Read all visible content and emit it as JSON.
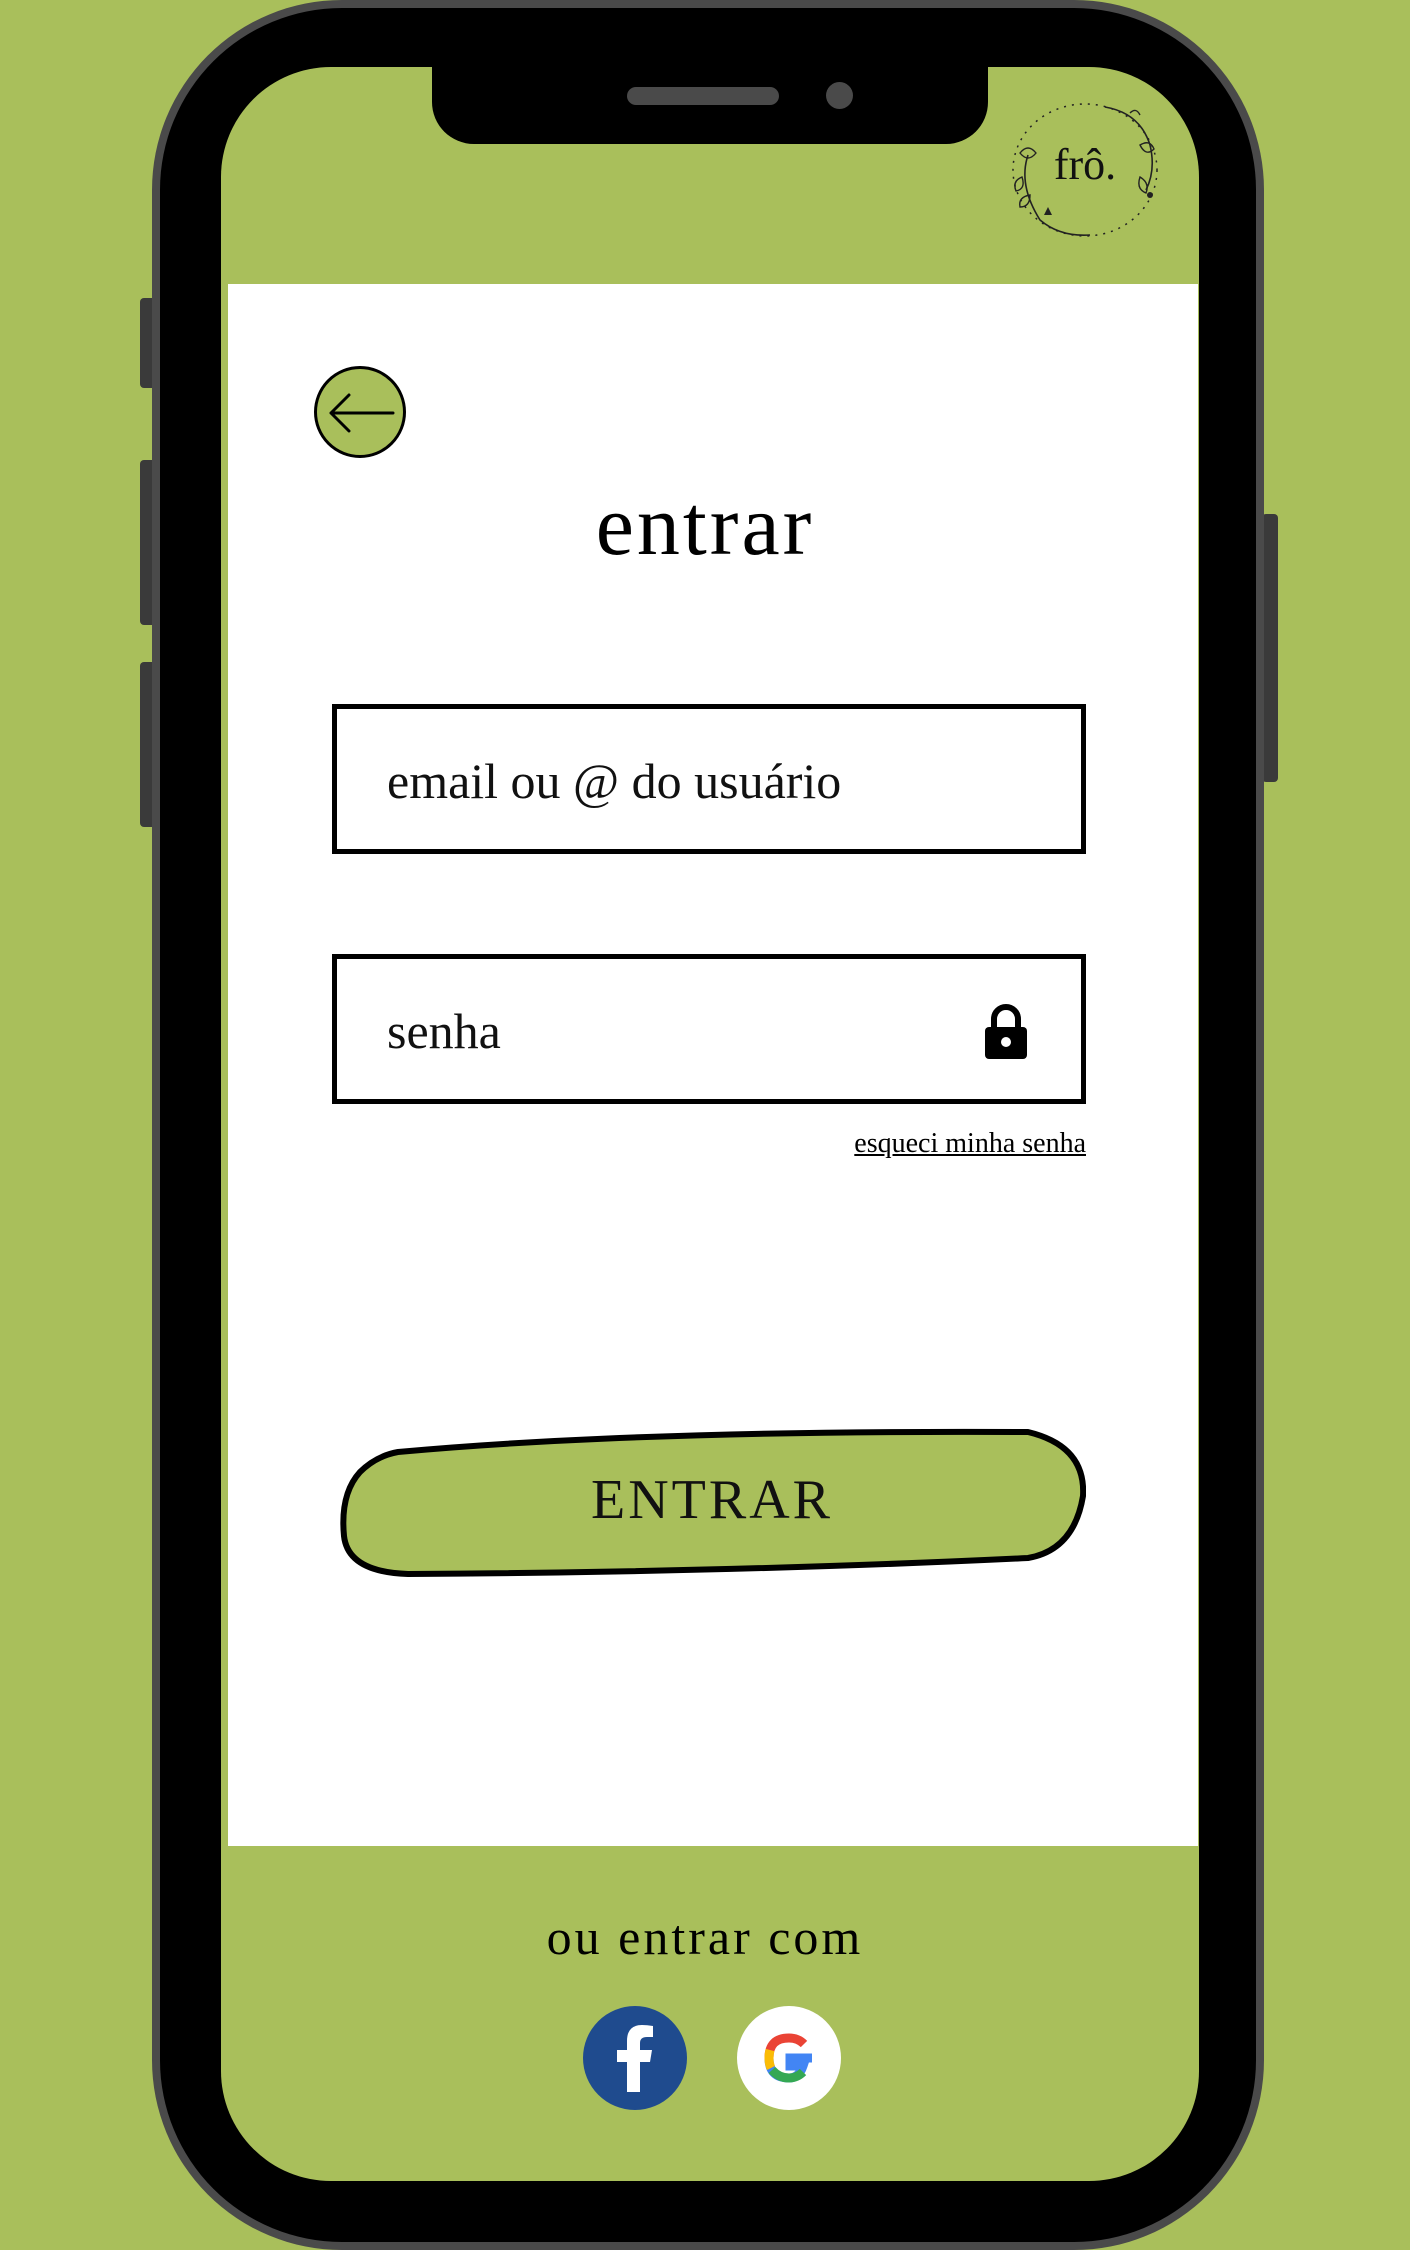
{
  "brand": {
    "logo_text": "frô."
  },
  "login": {
    "title": "entrar",
    "email_placeholder": "email ou @ do usuário",
    "password_placeholder": "senha",
    "forgot_password": "esqueci minha senha",
    "submit_label": "ENTRAR"
  },
  "social": {
    "label": "ou entrar com",
    "providers": [
      {
        "name": "facebook",
        "icon": "facebook-icon",
        "color": "#1f4b8e"
      },
      {
        "name": "google",
        "icon": "google-icon",
        "color": "#ffffff"
      }
    ]
  },
  "theme": {
    "accent": "#a9bf5b",
    "frame": "#4a4a4a",
    "text": "#000000"
  }
}
